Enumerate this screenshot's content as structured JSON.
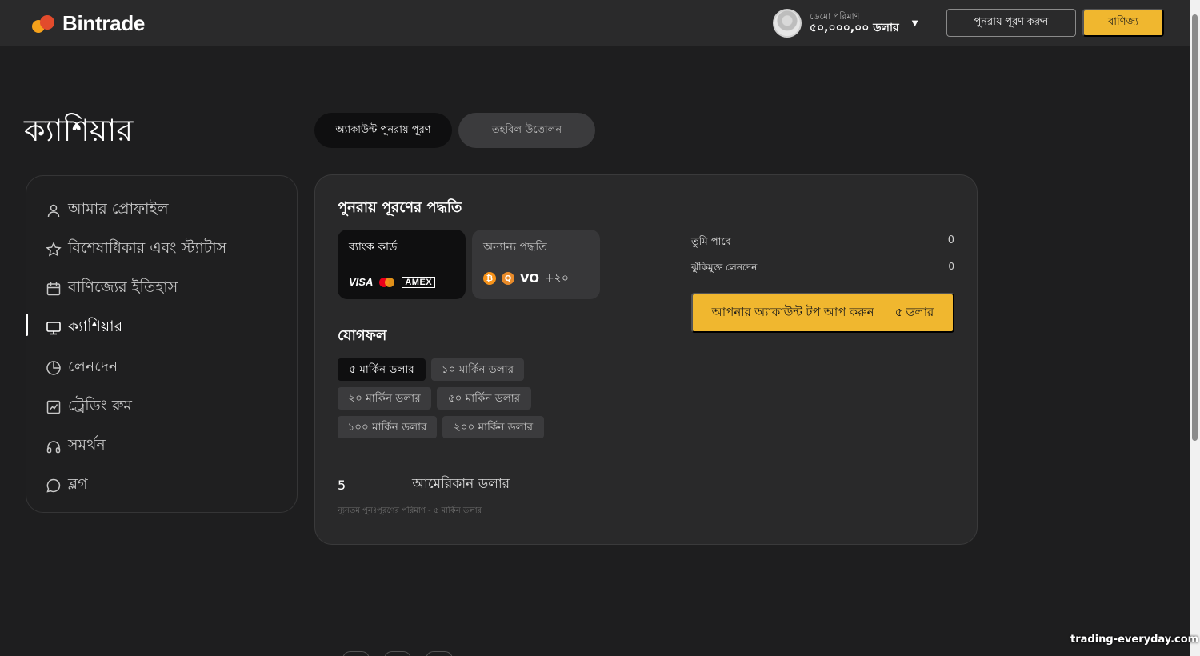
{
  "header": {
    "brand": "Bintrade",
    "account_label": "ডেমো পরিমাণ",
    "account_value": "৫০,০০০,০০ ডলার",
    "refill_button": "পুনরায় পূরণ করুন",
    "trade_button": "বাণিজ্য"
  },
  "page": {
    "title": "ক্যাশিয়ার"
  },
  "tabs": [
    {
      "label": "অ্যাকাউন্ট পুনরায় পূরণ",
      "active": true
    },
    {
      "label": "তহবিল উত্তোলন",
      "active": false
    }
  ],
  "sidebar": {
    "items": [
      {
        "label": "আমার প্রোফাইল",
        "icon": "user-icon"
      },
      {
        "label": "বিশেষাধিকার এবং স্ট্যাটাস",
        "icon": "star-icon"
      },
      {
        "label": "বাণিজ্যের ইতিহাস",
        "icon": "calendar-icon"
      },
      {
        "label": "ক্যাশিয়ার",
        "icon": "monitor-icon",
        "active": true
      },
      {
        "label": "লেনদেন",
        "icon": "pie-chart-icon"
      },
      {
        "label": "ট্রেডিং রুম",
        "icon": "line-chart-icon"
      },
      {
        "label": "সমর্থন",
        "icon": "headphones-icon"
      },
      {
        "label": "ব্লগ",
        "icon": "chat-icon"
      }
    ]
  },
  "refill": {
    "methods_title": "পুনরায় পূরণের পদ্ধতি",
    "methods": [
      {
        "name": "ব্যাংক কার্ড",
        "logos": [
          "VISA",
          "mastercard",
          "AMEX"
        ]
      },
      {
        "name": "অন্যান্য পদ্ধতি",
        "logos": [
          "bitcoin",
          "qiwi",
          "VO"
        ],
        "more": "+২০"
      }
    ],
    "sum_title": "যোগফল",
    "amounts": [
      "৫ মার্কিন ডলার",
      "১০ মার্কিন ডলার",
      "২০ মার্কিন ডলার",
      "৫০ মার্কিন ডলার",
      "১০০ মার্কিন ডলার",
      "২০০ মার্কিন ডলার"
    ],
    "amount_value": "5",
    "amount_currency": "আমেরিকান ডলার",
    "min_note": "ন্যূনতম পুনঃপূরণের পরিমাণ - ৫ মার্কিন ডলার",
    "you_get_label": "তুমি পাবে",
    "you_get_value": "0",
    "riskfree_label": "ঝুঁকিমুক্ত লেনদেন",
    "riskfree_value": "0",
    "topup_label": "আপনার অ্যাকাউন্ট টপ আপ করুন",
    "topup_amount": "৫ ডলার"
  },
  "watermark": "trading-everyday.com",
  "colors": {
    "accent": "#f0b72f",
    "background": "#1e1e1f",
    "panel": "#29292a",
    "topbar": "#2a2a2b"
  }
}
